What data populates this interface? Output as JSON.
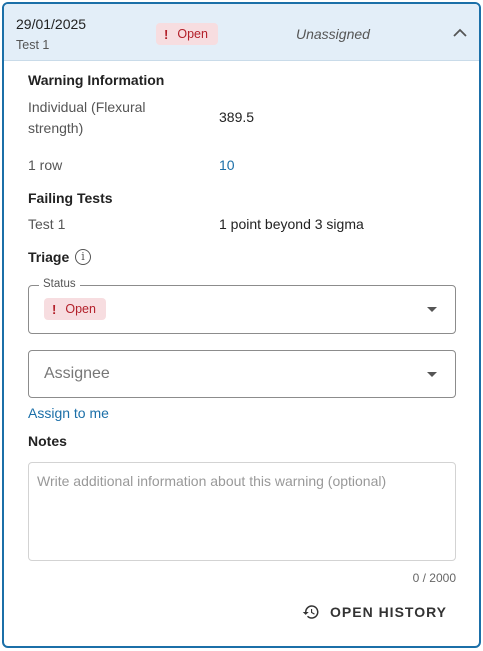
{
  "header": {
    "date": "29/01/2025",
    "subtitle": "Test 1",
    "status_badge": "Open",
    "assignee": "Unassigned",
    "collapse_icon": "chevron-up-icon"
  },
  "warning_info": {
    "title": "Warning Information",
    "metric_label": "Individual (Flexural strength)",
    "metric_value": "389.5",
    "row_label": "1 row",
    "row_value": "10"
  },
  "failing_tests": {
    "title": "Failing Tests",
    "test_name": "Test 1",
    "test_rule": "1 point beyond 3 sigma"
  },
  "triage": {
    "title": "Triage",
    "info_icon": "info-icon",
    "status_label": "Status",
    "status_value": "Open",
    "assignee_placeholder": "Assignee",
    "assign_to_me": "Assign to me",
    "notes_title": "Notes",
    "notes_placeholder": "Write additional information about this warning (optional)",
    "notes_value": "",
    "notes_counter": "0 / 2000",
    "notes_max": 2000
  },
  "actions": {
    "open_history": "OPEN HISTORY",
    "history_icon": "history-icon"
  },
  "colors": {
    "accent": "#1b6fa8",
    "header_bg": "#e3eef8",
    "badge_bg": "#f7dde0",
    "badge_text": "#b3202a"
  }
}
